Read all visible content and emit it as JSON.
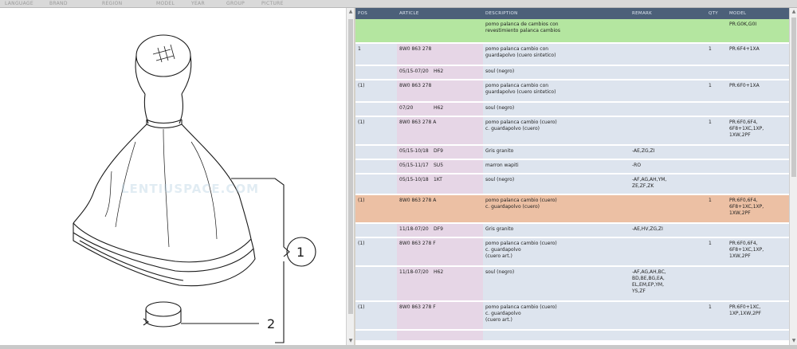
{
  "topbar": {
    "items": [
      "LANGUAGE",
      "BRAND",
      "REGION",
      "MODEL",
      "YEAR",
      "GROUP",
      "PICTURE"
    ]
  },
  "picture": {
    "watermark": "LENTIUSPACE.COM",
    "callouts": [
      "1",
      "2"
    ]
  },
  "table": {
    "headers": [
      "POS",
      "ARTICLE",
      "DESCRIPTION",
      "REMARK",
      "QTY",
      "MODEL"
    ],
    "rows": [
      {
        "type": "hdr",
        "pos": "",
        "article": "",
        "date": "",
        "code": "",
        "desc": "pomo palanca de cambios con\nrevestimiento palanca cambios",
        "remark": "",
        "qty": "",
        "model": "PR:G0K,G0I",
        "h": 30
      },
      {
        "type": "main",
        "pos": "1",
        "article": "8W0 863 278",
        "date": "",
        "code": "",
        "desc": "pomo palanca cambio con\nguardapolvo (cuero sintetico)",
        "remark": "",
        "qty": "1",
        "model": "PR:6F4+1XA",
        "h": 28
      },
      {
        "type": "sub",
        "pos": "",
        "article": "",
        "date": "05/15-07/20",
        "code": "H62",
        "desc": "soul (negro)",
        "remark": "",
        "qty": "",
        "model": "",
        "h": 18
      },
      {
        "type": "main",
        "pos": "(1)",
        "article": "8W0 863 278",
        "date": "",
        "code": "",
        "desc": "pomo palanca cambio con\nguardapolvo (cuero sintetico)",
        "remark": "",
        "qty": "1",
        "model": "PR:6F0+1XA",
        "h": 28
      },
      {
        "type": "sub",
        "pos": "",
        "article": "",
        "date": "07/20",
        "code": "H62",
        "desc": "soul (negro)",
        "remark": "",
        "qty": "",
        "model": "",
        "h": 18
      },
      {
        "type": "main",
        "pos": "(1)",
        "article": "8W0 863 278 A",
        "date": "",
        "code": "",
        "desc": "pomo palanca cambio (cuero)\nc. guardapolvo (cuero)",
        "remark": "",
        "qty": "1",
        "model": "PR:6F0,6F4,\n6F8+1XC,1XP,\n1XW,2PF",
        "h": 36
      },
      {
        "type": "sub",
        "pos": "",
        "article": "",
        "date": "05/15-10/18",
        "code": "DF9",
        "desc": "Gris granito",
        "remark": "-AE,ZG,ZI",
        "qty": "",
        "model": "",
        "h": 18
      },
      {
        "type": "sub",
        "pos": "",
        "article": "",
        "date": "05/15-11/17",
        "code": "SU5",
        "desc": "marron wapiti",
        "remark": "-RO",
        "qty": "",
        "model": "",
        "h": 18
      },
      {
        "type": "sub",
        "pos": "",
        "article": "",
        "date": "05/15-10/18",
        "code": "1KT",
        "desc": "soul (negro)",
        "remark": "-AF,AG,AH,YM,\nZE,ZF,ZK",
        "qty": "",
        "model": "",
        "h": 26
      },
      {
        "type": "sel",
        "pos": "(1)",
        "article": "8W0 863 278 A",
        "date": "",
        "code": "",
        "desc": "pomo palanca cambio (cuero)\nc. guardapolvo (cuero)",
        "remark": "",
        "qty": "1",
        "model": "PR:6F0,6F4,\n6F8+1XC,1XP,\n1XW,2PF",
        "h": 36
      },
      {
        "type": "sub",
        "pos": "",
        "article": "",
        "date": "11/18-07/20",
        "code": "DF9",
        "desc": "Gris granito",
        "remark": "-AE,HV,ZG,ZI",
        "qty": "",
        "model": "",
        "h": 18
      },
      {
        "type": "main",
        "pos": "(1)",
        "article": "8W0 863 278 F",
        "date": "",
        "code": "",
        "desc": "pomo palanca cambio (cuero)\nc. guardapolvo\n(cuero art.)",
        "remark": "",
        "qty": "1",
        "model": "PR:6F0,6F4,\n6F8+1XC,1XP,\n1XW,2PF",
        "h": 36
      },
      {
        "type": "sub",
        "pos": "",
        "article": "",
        "date": "11/18-07/20",
        "code": "H62",
        "desc": "soul (negro)",
        "remark": "-AF,AG,AH,BC,\nBD,BE,BG,EA,\nEL,EM,EP,YM,\nYS,ZF",
        "qty": "",
        "model": "",
        "h": 44
      },
      {
        "type": "main",
        "pos": "(1)",
        "article": "8W0 863 278 F",
        "date": "",
        "code": "",
        "desc": "pomo palanca cambio (cuero)\nc. guardapolvo\n(cuero art.)",
        "remark": "",
        "qty": "1",
        "model": "PR:6F0+1XC,\n1XP,1XW,2PF",
        "h": 36
      },
      {
        "type": "sub",
        "pos": "",
        "article": "",
        "date": "",
        "code": "",
        "desc": "",
        "remark": "",
        "qty": "",
        "model": "",
        "h": 14
      }
    ]
  }
}
